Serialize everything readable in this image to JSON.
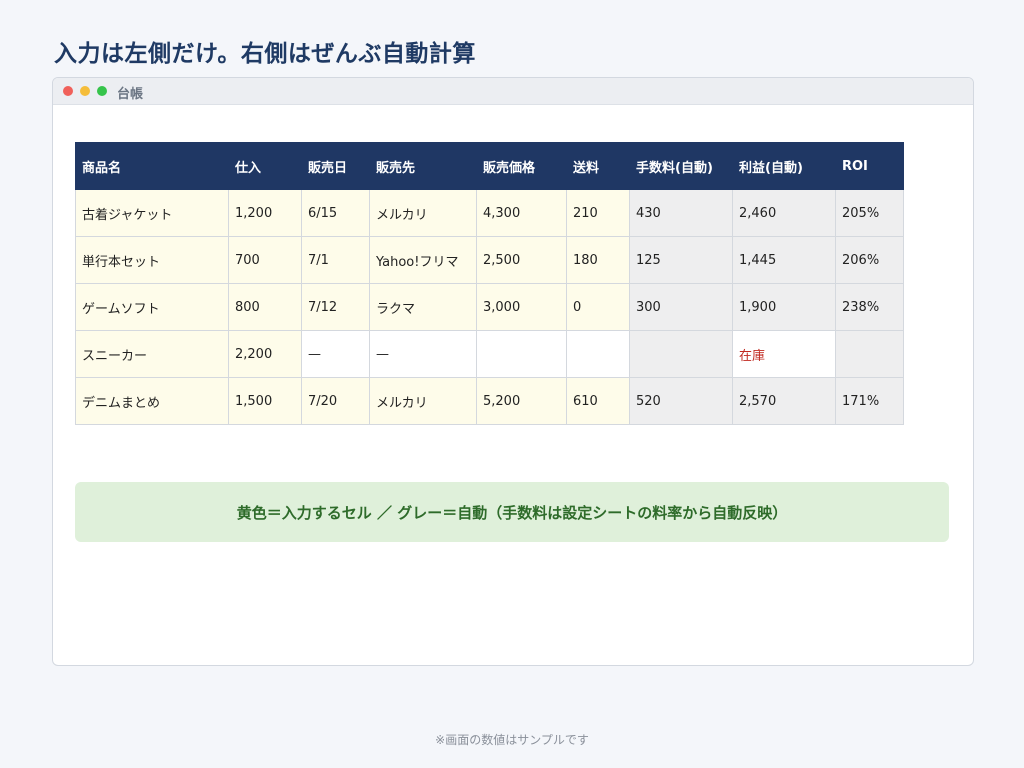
{
  "page": {
    "title": "入力は左側だけ。右側はぜんぶ自動計算",
    "footer": "※画面の数値はサンプルです"
  },
  "window": {
    "title": "台帳"
  },
  "table": {
    "headers": [
      "商品名",
      "仕入",
      "販売日",
      "販売先",
      "販売価格",
      "送料",
      "手数料(自動)",
      "利益(自動)",
      "ROI"
    ],
    "rows": [
      [
        "古着ジャケット",
        "1,200",
        "6/15",
        "メルカリ",
        "4,300",
        "210",
        "430",
        "2,460",
        "205%"
      ],
      [
        "単行本セット",
        "700",
        "7/1",
        "Yahoo!フリマ",
        "2,500",
        "180",
        "125",
        "1,445",
        "206%"
      ],
      [
        "ゲームソフト",
        "800",
        "7/12",
        "ラクマ",
        "3,000",
        "0",
        "300",
        "1,900",
        "238%"
      ],
      [
        "スニーカー",
        "2,200",
        "—",
        "—",
        "",
        "",
        "",
        "在庫",
        ""
      ],
      [
        "デニムまとめ",
        "1,500",
        "7/20",
        "メルカリ",
        "5,200",
        "610",
        "520",
        "2,570",
        "171%"
      ]
    ]
  },
  "note": {
    "text": "黄色＝入力するセル ／ グレー＝自動（手数料は設定シートの料率から自動反映）"
  },
  "colors": {
    "header_bg": "#1f3764",
    "input_cell": "#fefcea",
    "auto_cell": "#eeeeef",
    "stock_text": "#c0281f",
    "note_bg": "#dff0da"
  }
}
